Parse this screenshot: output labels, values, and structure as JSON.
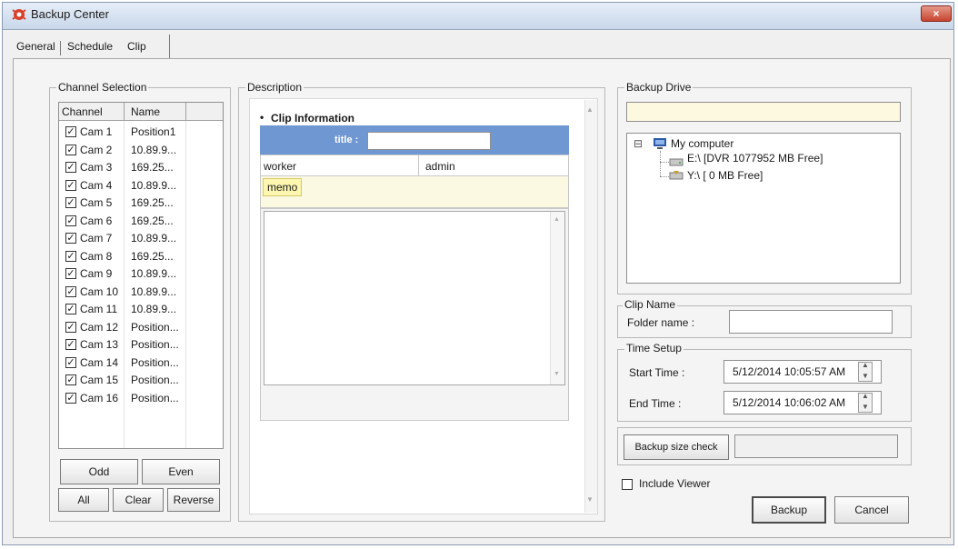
{
  "window": {
    "title": "Backup Center",
    "close_glyph": "×"
  },
  "tabs": [
    {
      "label": "General"
    },
    {
      "label": "Schedule"
    },
    {
      "label": "Clip"
    }
  ],
  "channel_selection": {
    "legend": "Channel Selection",
    "columns": [
      "Channel",
      "Name"
    ],
    "rows": [
      {
        "cam": "Cam 1",
        "name": "Position1"
      },
      {
        "cam": "Cam 2",
        "name": "10.89.9..."
      },
      {
        "cam": "Cam 3",
        "name": "169.25..."
      },
      {
        "cam": "Cam 4",
        "name": "10.89.9..."
      },
      {
        "cam": "Cam 5",
        "name": "169.25..."
      },
      {
        "cam": "Cam 6",
        "name": "169.25..."
      },
      {
        "cam": "Cam 7",
        "name": "10.89.9..."
      },
      {
        "cam": "Cam 8",
        "name": "169.25..."
      },
      {
        "cam": "Cam 9",
        "name": "10.89.9..."
      },
      {
        "cam": "Cam 10",
        "name": "10.89.9..."
      },
      {
        "cam": "Cam 11",
        "name": "10.89.9..."
      },
      {
        "cam": "Cam 12",
        "name": "Position..."
      },
      {
        "cam": "Cam 13",
        "name": "Position..."
      },
      {
        "cam": "Cam 14",
        "name": "Position..."
      },
      {
        "cam": "Cam 15",
        "name": "Position..."
      },
      {
        "cam": "Cam 16",
        "name": "Position..."
      }
    ],
    "buttons": {
      "odd": "Odd",
      "even": "Even",
      "all": "All",
      "clear": "Clear",
      "reverse": "Reverse"
    }
  },
  "description": {
    "legend": "Description",
    "heading": "Clip Information",
    "bullet": "•",
    "title_label": "title :",
    "title_value": "",
    "worker_label": "worker",
    "worker_value": "admin",
    "memo_label": "memo",
    "memo_value": ""
  },
  "backup_drive": {
    "legend": "Backup Drive",
    "path_value": "",
    "tree": {
      "root": "My computer",
      "expander": "⊟",
      "drives": [
        "E:\\ [DVR 1077952 MB Free]",
        "Y:\\ [ 0 MB Free]"
      ]
    }
  },
  "clip_name": {
    "legend": "Clip Name",
    "folder_label": "Folder name :",
    "folder_value": ""
  },
  "time_setup": {
    "legend": "Time Setup",
    "start_label": "Start Time :",
    "start_value": "5/12/2014 10:05:57 AM",
    "end_label": "End Time :",
    "end_value": "5/12/2014 10:06:02 AM"
  },
  "backup_size": {
    "button": "Backup size check",
    "value": ""
  },
  "include_viewer": {
    "label": "Include Viewer",
    "checked": false
  },
  "actions": {
    "backup": "Backup",
    "cancel": "Cancel"
  },
  "colors": {
    "title_header": "#6f97d2",
    "memo_bg": "#fbf9e2",
    "close": "#c8442e"
  }
}
